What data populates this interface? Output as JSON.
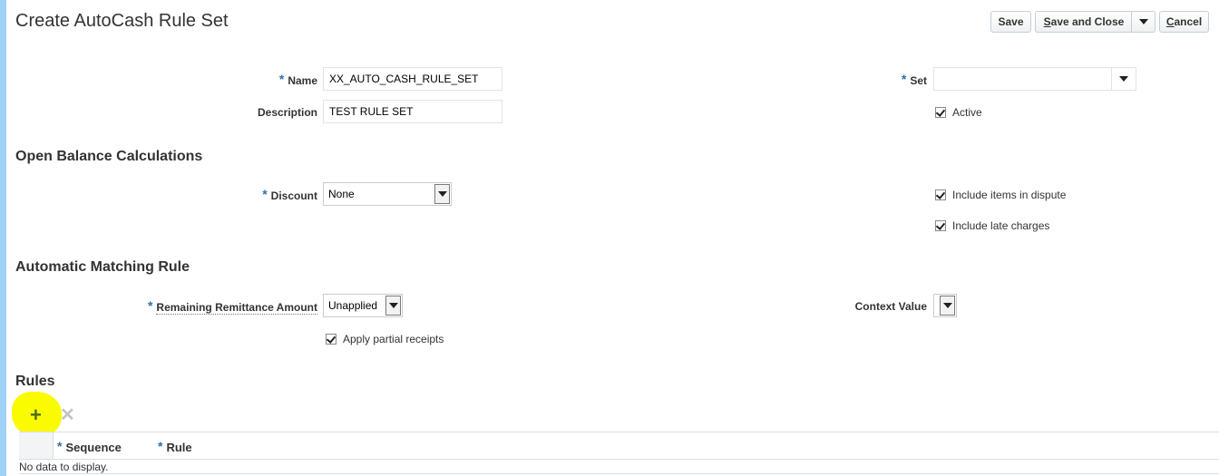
{
  "page": {
    "title": "Create AutoCash Rule Set"
  },
  "toolbar": {
    "save_label": "Save",
    "save_close_label": "Save and Close",
    "cancel_label": "Cancel"
  },
  "header_form": {
    "name_label": "Name",
    "name_value": "XX_AUTO_CASH_RULE_SET",
    "description_label": "Description",
    "description_value": "TEST RULE SET",
    "set_label": "Set",
    "set_value": "",
    "active_label": "Active",
    "active_checked": true
  },
  "open_balance": {
    "heading": "Open Balance Calculations",
    "discount_label": "Discount",
    "discount_value": "None",
    "include_dispute_label": "Include items in dispute",
    "include_dispute_checked": true,
    "include_late_label": "Include late charges",
    "include_late_checked": true
  },
  "matching_rule": {
    "heading": "Automatic Matching Rule",
    "remaining_label": "Remaining Remittance Amount",
    "remaining_value": "Unapplied",
    "context_label": "Context Value",
    "context_value": "",
    "partial_label": "Apply partial receipts",
    "partial_checked": true
  },
  "rules": {
    "heading": "Rules",
    "add_icon": "plus-icon",
    "delete_icon": "x-icon",
    "columns": [
      "Sequence",
      "Rule"
    ],
    "empty_text": "No data to display."
  },
  "colors": {
    "required_asterisk": "#2e6fa7",
    "left_accent": "#9fd2f7",
    "highlight": "#fbfb00"
  }
}
